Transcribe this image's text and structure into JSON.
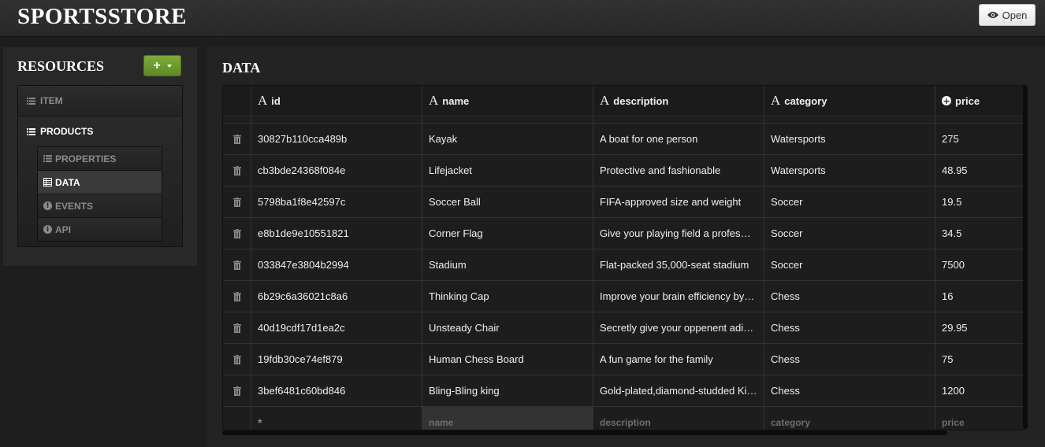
{
  "header": {
    "brand": "SPORTSSTORE",
    "open_label": "Open"
  },
  "sidebar": {
    "title": "RESOURCES",
    "add_label": "+",
    "items": [
      {
        "label": "ITEM"
      },
      {
        "label": "PRODUCTS"
      }
    ],
    "sub_items": [
      {
        "label": "PROPERTIES"
      },
      {
        "label": "DATA"
      },
      {
        "label": "EVENTS"
      },
      {
        "label": "API"
      }
    ]
  },
  "main": {
    "title": "DATA",
    "columns": {
      "id": "id",
      "name": "name",
      "description": "description",
      "category": "category",
      "price": "price"
    },
    "rows": [
      {
        "id": "30827b110cca489b",
        "name": "Kayak",
        "description": "A boat for one person",
        "category": "Watersports",
        "price": "275"
      },
      {
        "id": "cb3bde24368f084e",
        "name": "Lifejacket",
        "description": "Protective and fashionable",
        "category": "Watersports",
        "price": "48.95"
      },
      {
        "id": "5798ba1f8e42597c",
        "name": "Soccer Ball",
        "description": "FIFA-approved size and weight",
        "category": "Soccer",
        "price": "19.5"
      },
      {
        "id": "e8b1de9e10551821",
        "name": "Corner Flag",
        "description": "Give your playing field a profes…",
        "category": "Soccer",
        "price": "34.5"
      },
      {
        "id": "033847e3804b2994",
        "name": "Stadium",
        "description": "Flat-packed 35,000-seat stadium",
        "category": "Soccer",
        "price": "7500"
      },
      {
        "id": "6b29c6a36021c8a6",
        "name": "Thinking Cap",
        "description": "Improve your brain efficiency by…",
        "category": "Chess",
        "price": "16"
      },
      {
        "id": "40d19cdf17d1ea2c",
        "name": "Unsteady Chair",
        "description": "Secretly give your oppenent adi…",
        "category": "Chess",
        "price": "29.95"
      },
      {
        "id": "19fdb30ce74ef879",
        "name": "Human Chess Board",
        "description": "A fun game for the family",
        "category": "Chess",
        "price": "75"
      },
      {
        "id": "3bef6481c60bd846",
        "name": "Bling-Bling king",
        "description": "Gold-plated,diamond-studded King",
        "category": "Chess",
        "price": "1200"
      }
    ],
    "new_row": {
      "id_marker": "*",
      "name_placeholder": "name",
      "description_placeholder": "description",
      "category_placeholder": "category",
      "price_placeholder": "price"
    }
  },
  "colors": {
    "accent_green": "#6a9a2c",
    "background": "#1e1e1e"
  }
}
